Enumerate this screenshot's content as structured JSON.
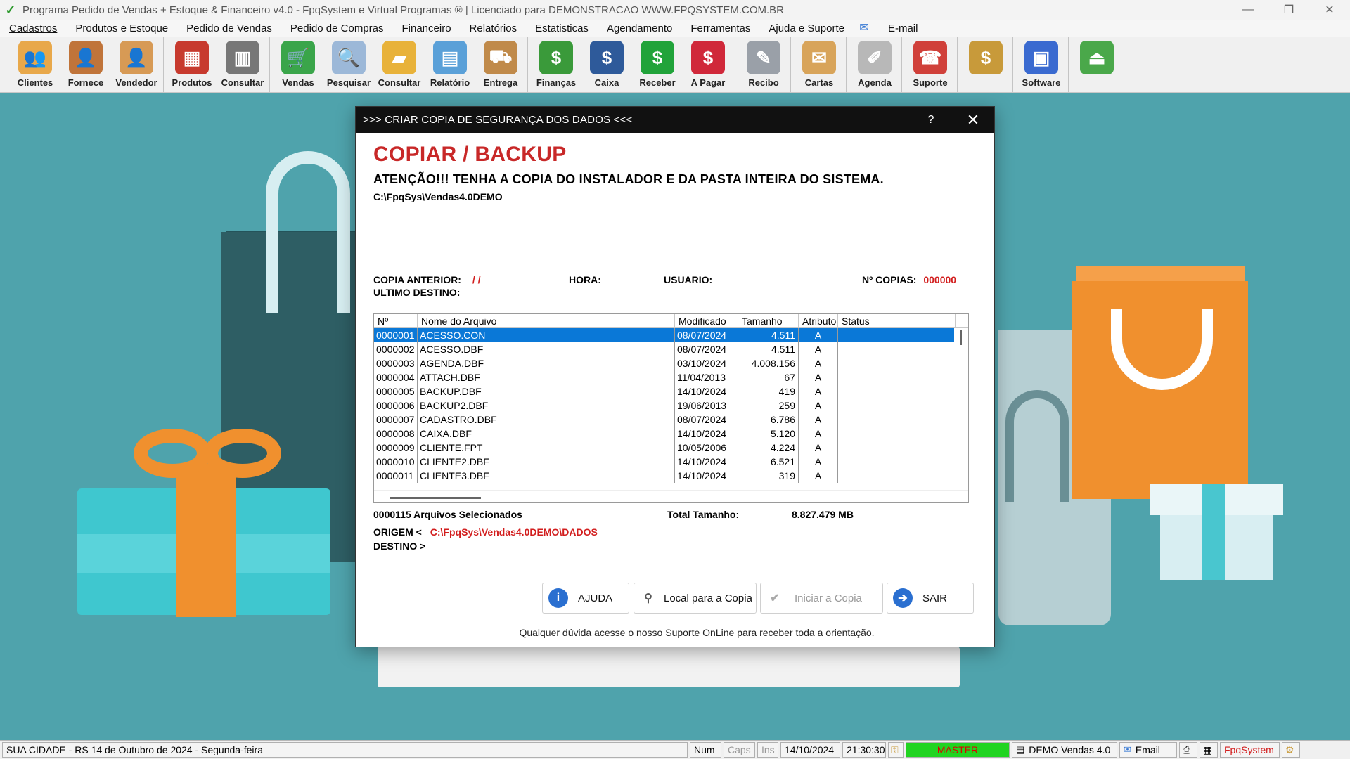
{
  "window": {
    "title": "Programa Pedido de Vendas + Estoque & Financeiro v4.0 - FpqSystem e Virtual Programas ® | Licenciado para  DEMONSTRACAO WWW.FPQSYSTEM.COM.BR",
    "minimize": "—",
    "restore": "❐",
    "close": "✕"
  },
  "menu": [
    "Cadastros",
    "Produtos e Estoque",
    "Pedido de Vendas",
    "Pedido de Compras",
    "Financeiro",
    "Relatórios",
    "Estatisticas",
    "Agendamento",
    "Ferramentas",
    "Ajuda e Suporte"
  ],
  "menu_email": "E-mail",
  "toolbar": {
    "groups": [
      [
        {
          "label": "Clientes",
          "icon": "clients-icon",
          "glyph": "👥",
          "color": "#e8a84a"
        },
        {
          "label": "Fornece",
          "icon": "supplier-icon",
          "glyph": "👤",
          "color": "#c0743a"
        },
        {
          "label": "Vendedor",
          "icon": "seller-icon",
          "glyph": "👤",
          "color": "#d79a55"
        }
      ],
      [
        {
          "label": "Produtos",
          "icon": "products-icon",
          "glyph": "▦",
          "color": "#c73a2e"
        },
        {
          "label": "Consultar",
          "icon": "barcode-icon",
          "glyph": "▥",
          "color": "#777777"
        }
      ],
      [
        {
          "label": "Vendas",
          "icon": "cart-icon",
          "glyph": "🛒",
          "color": "#3aa54a"
        },
        {
          "label": "Pesquisar",
          "icon": "search-doc-icon",
          "glyph": "🔍",
          "color": "#9cb8d8"
        },
        {
          "label": "Consultar",
          "icon": "folder-icon",
          "glyph": "▰",
          "color": "#e8b23a"
        },
        {
          "label": "Relatório",
          "icon": "report-icon",
          "glyph": "▤",
          "color": "#5aa0d8"
        },
        {
          "label": "Entrega",
          "icon": "hand-truck-icon",
          "glyph": "⛟",
          "color": "#c08a4a"
        }
      ],
      [
        {
          "label": "Finanças",
          "icon": "finance-icon",
          "glyph": "$",
          "color": "#3a9a3a"
        },
        {
          "label": "Caixa",
          "icon": "cashbox-icon",
          "glyph": "$",
          "color": "#2e5a9a"
        },
        {
          "label": "Receber",
          "icon": "receive-icon",
          "glyph": "$",
          "color": "#21a33a"
        },
        {
          "label": "A Pagar",
          "icon": "pay-icon",
          "glyph": "$",
          "color": "#d0283a"
        }
      ],
      [
        {
          "label": "Recibo",
          "icon": "receipt-icon",
          "glyph": "✎",
          "color": "#9aa0a8"
        }
      ],
      [
        {
          "label": "Cartas",
          "icon": "letters-icon",
          "glyph": "✉",
          "color": "#d8a45a"
        }
      ],
      [
        {
          "label": "Agenda",
          "icon": "calendar-icon",
          "glyph": "✐",
          "color": "#b8b8b8"
        }
      ],
      [
        {
          "label": "Suporte",
          "icon": "support-icon",
          "glyph": "☎",
          "color": "#d0403a"
        }
      ],
      [
        {
          "label": "",
          "icon": "coin-icon",
          "glyph": "$",
          "color": "#c89a3a"
        }
      ],
      [
        {
          "label": "Software",
          "icon": "software-icon",
          "glyph": "▣",
          "color": "#3a6ad0"
        }
      ],
      [
        {
          "label": "",
          "icon": "exit-icon",
          "glyph": "⏏",
          "color": "#4aa84a"
        }
      ]
    ]
  },
  "dialog": {
    "title": ">>> CRIAR COPIA DE SEGURANÇA DOS DADOS <<<",
    "help": "?",
    "close": "✕",
    "heading": "COPIAR / BACKUP",
    "warning": "ATENÇÃO!!!  TENHA A COPIA DO INSTALADOR E DA PASTA INTEIRA DO SISTEMA.",
    "path": "C:\\FpqSys\\Vendas4.0DEMO",
    "copia_anterior_label": "COPIA ANTERIOR:",
    "copia_anterior_value": "/ /",
    "hora_label": "HORA:",
    "usuario_label": "USUARIO:",
    "n_copias_label": "Nº COPIAS:",
    "n_copias_value": "000000",
    "ultimo_destino_label": "ULTIMO DESTINO:",
    "table": {
      "columns": [
        "Nº",
        "Nome do Arquivo",
        "Modificado",
        "Tamanho",
        "Atributo",
        "Status"
      ],
      "rows": [
        [
          "0000001",
          "ACESSO.CON",
          "08/07/2024",
          "4.511",
          "A",
          ""
        ],
        [
          "0000002",
          "ACESSO.DBF",
          "08/07/2024",
          "4.511",
          "A",
          ""
        ],
        [
          "0000003",
          "AGENDA.DBF",
          "03/10/2024",
          "4.008.156",
          "A",
          ""
        ],
        [
          "0000004",
          "ATTACH.DBF",
          "11/04/2013",
          "67",
          "A",
          ""
        ],
        [
          "0000005",
          "BACKUP.DBF",
          "14/10/2024",
          "419",
          "A",
          ""
        ],
        [
          "0000006",
          "BACKUP2.DBF",
          "19/06/2013",
          "259",
          "A",
          ""
        ],
        [
          "0000007",
          "CADASTRO.DBF",
          "08/07/2024",
          "6.786",
          "A",
          ""
        ],
        [
          "0000008",
          "CAIXA.DBF",
          "14/10/2024",
          "5.120",
          "A",
          ""
        ],
        [
          "0000009",
          "CLIENTE.FPT",
          "10/05/2006",
          "4.224",
          "A",
          ""
        ],
        [
          "0000010",
          "CLIENTE2.DBF",
          "14/10/2024",
          "6.521",
          "A",
          ""
        ],
        [
          "0000011",
          "CLIENTE3.DBF",
          "14/10/2024",
          "319",
          "A",
          ""
        ]
      ]
    },
    "selected_files": "0000115 Arquivos Selecionados",
    "total_label": "Total Tamanho:",
    "total_value": "8.827.479 MB",
    "origem_label": "ORIGEM <",
    "origem_value": "C:\\FpqSys\\Vendas4.0DEMO\\DADOS",
    "destino_label": "DESTINO >",
    "buttons": {
      "ajuda": "AJUDA",
      "local": "Local para a Copia",
      "iniciar": "Iniciar a Copia",
      "sair": "SAIR"
    },
    "footnote": "Qualquer dúvida acesse o nosso Suporte OnLine para receber toda a orientação."
  },
  "statusbar": {
    "location_date": "SUA CIDADE - RS 14 de Outubro de 2024 - Segunda-feira",
    "num": "Num",
    "caps": "Caps",
    "ins": "Ins",
    "date": "14/10/2024",
    "time": "21:30:30",
    "user": "MASTER",
    "version": "DEMO Vendas 4.0",
    "email": "Email",
    "brand": "FpqSystem"
  },
  "colors": {
    "background": "#4fa3ac",
    "heading_red": "#c82828",
    "selection_blue": "#0a78d7",
    "master_green": "#21d421"
  }
}
